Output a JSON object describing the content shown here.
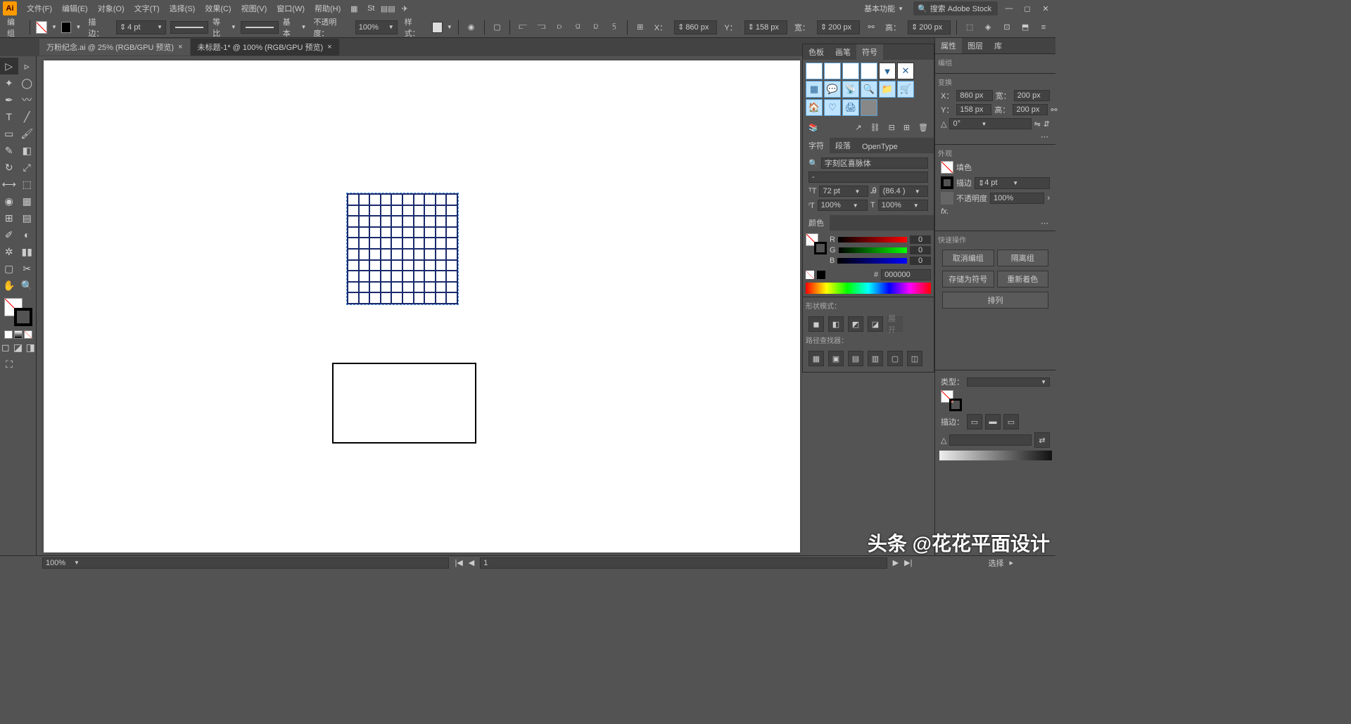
{
  "menubar": {
    "items": [
      "文件(F)",
      "编辑(E)",
      "对象(O)",
      "文字(T)",
      "选择(S)",
      "效果(C)",
      "视图(V)",
      "窗口(W)",
      "帮助(H)"
    ],
    "workspace": "基本功能",
    "search_placeholder": "搜索 Adobe Stock"
  },
  "controlbar": {
    "selection_label": "编组",
    "stroke_label": "描边：",
    "stroke_weight": "4 pt",
    "uniform_label": "等比",
    "profile_label": "基本",
    "opacity_label": "不透明度：",
    "opacity_value": "100%",
    "style_label": "样式：",
    "x_label": "X：",
    "x_value": "860 px",
    "y_label": "Y：",
    "y_value": "158 px",
    "w_label": "宽：",
    "w_value": "200 px",
    "h_label": "高：",
    "h_value": "200 px"
  },
  "tabs": [
    {
      "label": "万粉纪念.ai @ 25% (RGB/GPU 预览)"
    },
    {
      "label": "未标题-1* @ 100% (RGB/GPU 预览)"
    }
  ],
  "symbols_panel": {
    "tabs": [
      "色板",
      "画笔",
      "符号"
    ],
    "active": 2
  },
  "char_panel": {
    "tabs": [
      "字符",
      "段落",
      "OpenType"
    ],
    "active": 0,
    "font": "字刻区喜脉体",
    "size": "72 pt",
    "leading": "(86.4 )",
    "tracking1": "100%",
    "tracking2": "100%"
  },
  "color_panel": {
    "title": "颜色",
    "r": "0",
    "g": "0",
    "b": "0",
    "hex_label": "#",
    "hex": "000000"
  },
  "shape_modes_label": "形状模式：",
  "pathfinder_label": "路径查找器：",
  "properties": {
    "tabs": [
      "属性",
      "图层",
      "库"
    ],
    "active": 0,
    "selection": "编组",
    "transform_title": "变换",
    "x_lbl": "X：",
    "x": "860 px",
    "y_lbl": "Y：",
    "y": "158 px",
    "w_lbl": "宽：",
    "w": "200 px",
    "h_lbl": "高：",
    "h": "200 px",
    "angle_lbl": "△",
    "angle": "0°",
    "appearance_title": "外观",
    "fill_lbl": "填色",
    "stroke_lbl": "描边",
    "stroke_val": "4 pt",
    "opacity_lbl": "不透明度",
    "opacity_val": "100%",
    "quick_title": "快速操作",
    "btn_ungroup": "取消编组",
    "btn_isolate": "隔离组",
    "btn_save_symbol": "存储为符号",
    "btn_recolor": "重新着色",
    "btn_arrange": "排列"
  },
  "stroke_panel": {
    "type_lbl": "类型：",
    "stroke_lbl": "描边："
  },
  "statusbar": {
    "zoom": "100%",
    "page": "1",
    "tool": "选择"
  }
}
